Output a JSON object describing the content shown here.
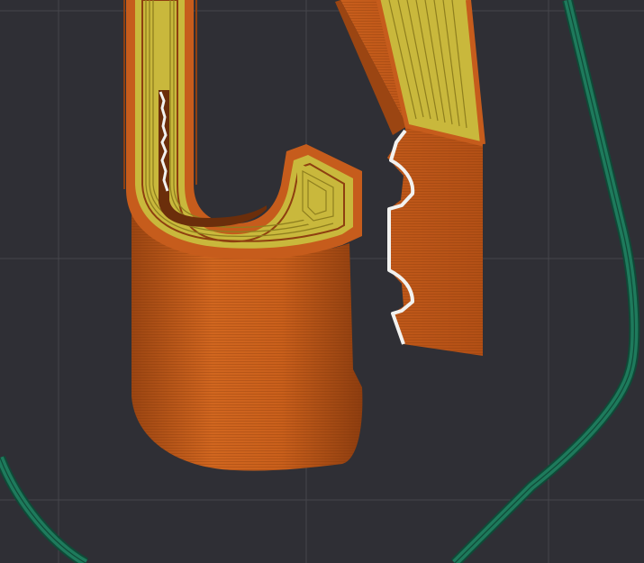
{
  "viewport": {
    "kind": "3d-slicer-preview",
    "background_color": "#2f2f35",
    "grid_line_color": "#45454c",
    "grid_visible": true
  },
  "colors": {
    "perimeter": "#c65c1c",
    "perimeter_dark": "#8e3f10",
    "perimeter_light": "#d9742c",
    "infill": "#c9b83c",
    "infill_line": "#8f7f1e",
    "support_interface": "#f2f2f0",
    "skirt": "#1e7a5c",
    "skirt_outline": "#0f4a37"
  },
  "objects": [
    {
      "name": "left-part",
      "kind": "hook-shaped-printed-part"
    },
    {
      "name": "right-part",
      "kind": "slanted-bar-printed-part"
    },
    {
      "name": "skirt",
      "kind": "skirt-brim-outline"
    }
  ]
}
